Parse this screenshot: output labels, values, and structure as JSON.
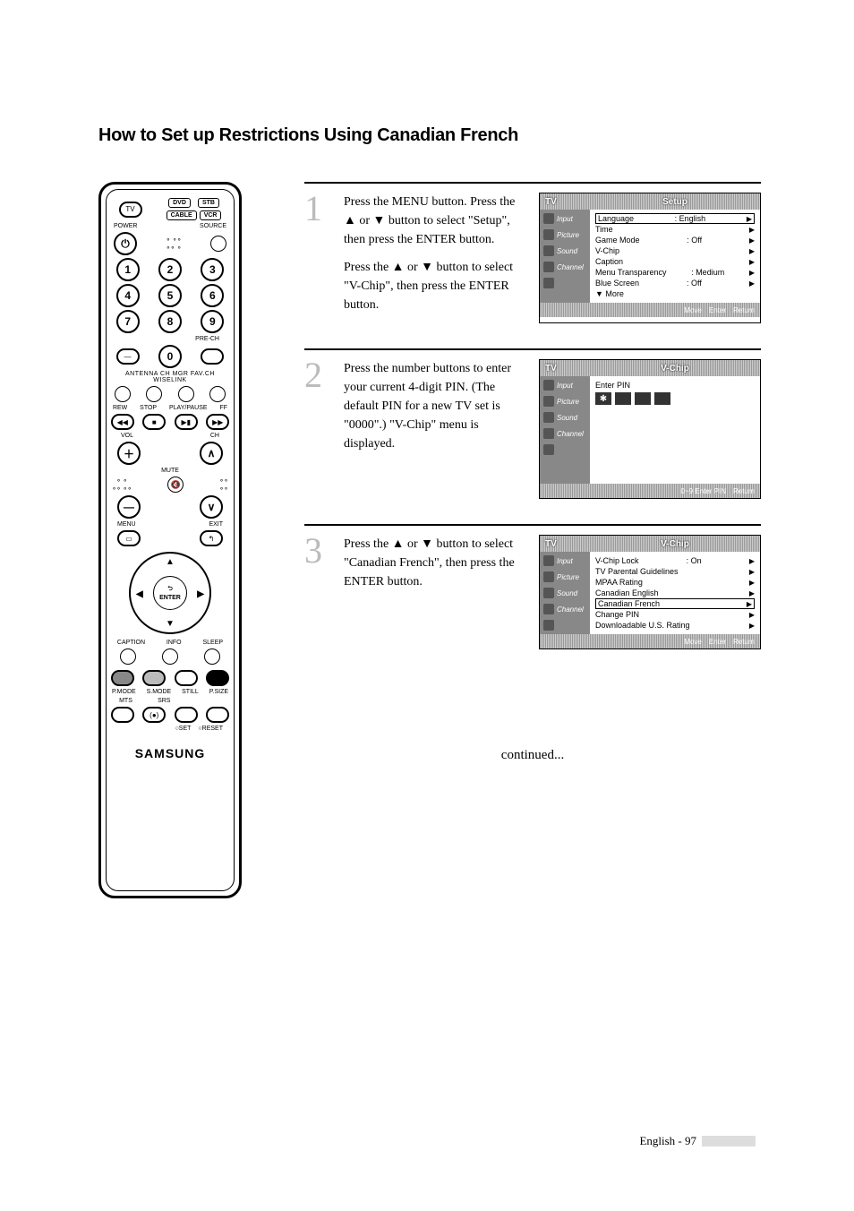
{
  "title": "How to Set up Restrictions Using Canadian French",
  "remote": {
    "tv": "TV",
    "dvd": "DVD",
    "stb": "STB",
    "cable": "CABLE",
    "vcr": "VCR",
    "power": "POWER",
    "source": "SOURCE",
    "nums": [
      "1",
      "2",
      "3",
      "4",
      "5",
      "6",
      "7",
      "8",
      "9",
      "0"
    ],
    "pre_ch": "PRE-CH",
    "row_labels_1": "ANTENNA  CH MGR  FAV.CH  WISELINK",
    "rew": "REW",
    "stop": "STOP",
    "playpause": "PLAY/PAUSE",
    "ff": "FF",
    "vol": "VOL",
    "ch": "CH",
    "mute": "MUTE",
    "menu": "MENU",
    "exit": "EXIT",
    "enter": "ENTER",
    "caption": "CAPTION",
    "info": "INFO",
    "sleep": "SLEEP",
    "pmode": "P.MODE",
    "smode": "S.MODE",
    "still": "STILL",
    "psize": "P.SIZE",
    "mts": "MTS",
    "srs": "SRS",
    "set": "SET",
    "reset": "RESET",
    "brand": "SAMSUNG"
  },
  "steps": [
    {
      "num": "1",
      "paras": [
        "Press the MENU button. Press the ▲ or ▼ button to select \"Setup\", then press the ENTER button.",
        "Press the ▲ or ▼ button to select \"V-Chip\", then press the ENTER button."
      ],
      "osd": {
        "tv": "TV",
        "title": "Setup",
        "side": [
          "Input",
          "Picture",
          "Sound",
          "Channel",
          ""
        ],
        "rows": [
          {
            "l": "Language",
            "r": ": English",
            "arrow": "▶",
            "boxed": true
          },
          {
            "l": "Time",
            "r": "",
            "arrow": "▶"
          },
          {
            "l": "Game Mode",
            "r": ": Off",
            "arrow": "▶"
          },
          {
            "l": "V-Chip",
            "r": "",
            "arrow": "▶"
          },
          {
            "l": "Caption",
            "r": "",
            "arrow": "▶"
          },
          {
            "l": "Menu Transparency",
            "r": ": Medium",
            "arrow": "▶"
          },
          {
            "l": "Blue Screen",
            "r": ": Off",
            "arrow": "▶"
          },
          {
            "l": "▼ More",
            "r": "",
            "arrow": ""
          }
        ],
        "footer": [
          "Move",
          "Enter",
          "Return"
        ]
      }
    },
    {
      "num": "2",
      "paras": [
        "Press the number buttons to enter your current 4-digit PIN. (The default PIN for a new TV set is \"0000\".) \"V-Chip\" menu is displayed."
      ],
      "osd": {
        "tv": "TV",
        "title": "V-Chip",
        "side": [
          "Input",
          "Picture",
          "Sound",
          "Channel",
          ""
        ],
        "pin_label": "Enter PIN",
        "footer": [
          "0~9 Enter PIN",
          "Return"
        ]
      }
    },
    {
      "num": "3",
      "paras": [
        "Press the ▲ or ▼ button to select \"Canadian French\", then press the ENTER button."
      ],
      "osd": {
        "tv": "TV",
        "title": "V-Chip",
        "side": [
          "Input",
          "Picture",
          "Sound",
          "Channel",
          ""
        ],
        "rows": [
          {
            "l": "V-Chip Lock",
            "r": ": On",
            "arrow": "▶"
          },
          {
            "l": "TV Parental Guidelines",
            "r": "",
            "arrow": "▶"
          },
          {
            "l": "MPAA Rating",
            "r": "",
            "arrow": "▶"
          },
          {
            "l": "Canadian English",
            "r": "",
            "arrow": "▶"
          },
          {
            "l": "Canadian French",
            "r": "",
            "arrow": "▶",
            "boxed": true
          },
          {
            "l": "Change PIN",
            "r": "",
            "arrow": "▶"
          },
          {
            "l": "Downloadable U.S. Rating",
            "r": "",
            "arrow": "▶"
          }
        ],
        "footer": [
          "Move",
          "Enter",
          "Return"
        ]
      }
    }
  ],
  "continued": "continued...",
  "footer": "English - 97"
}
